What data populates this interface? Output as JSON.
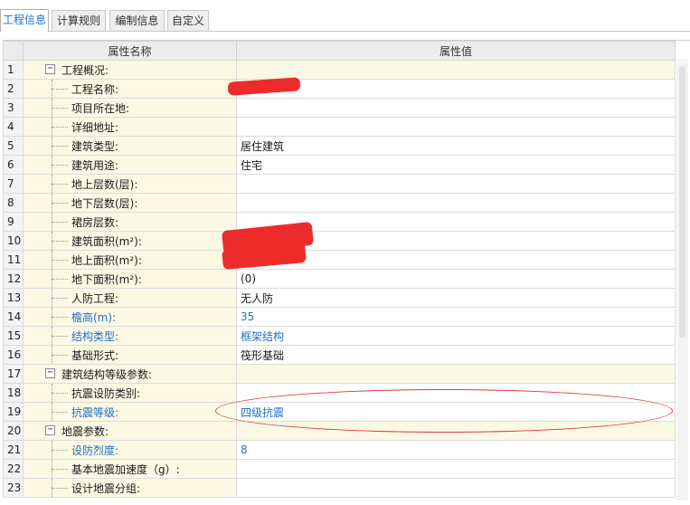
{
  "tabs": [
    {
      "label": "工程信息",
      "active": true
    },
    {
      "label": "计算规则",
      "active": false
    },
    {
      "label": "编制信息",
      "active": false
    },
    {
      "label": "自定义",
      "active": false
    }
  ],
  "grid": {
    "headers": {
      "name": "属性名称",
      "value": "属性值"
    },
    "rows": [
      {
        "num": "1",
        "name": "工程概况:",
        "value": "",
        "group": true,
        "expander": "−"
      },
      {
        "num": "2",
        "name": "工程名称:",
        "value": ""
      },
      {
        "num": "3",
        "name": "项目所在地:",
        "value": ""
      },
      {
        "num": "4",
        "name": "详细地址:",
        "value": ""
      },
      {
        "num": "5",
        "name": "建筑类型:",
        "value": "居住建筑"
      },
      {
        "num": "6",
        "name": "建筑用途:",
        "value": "住宅"
      },
      {
        "num": "7",
        "name": "地上层数(层):",
        "value": ""
      },
      {
        "num": "8",
        "name": "地下层数(层):",
        "value": ""
      },
      {
        "num": "9",
        "name": "裙房层数:",
        "value": ""
      },
      {
        "num": "10",
        "name": "建筑面积(m²):",
        "value": ""
      },
      {
        "num": "11",
        "name": "地上面积(m²):",
        "value": ""
      },
      {
        "num": "12",
        "name": "地下面积(m²):",
        "value": "(0)"
      },
      {
        "num": "13",
        "name": "人防工程:",
        "value": "无人防"
      },
      {
        "num": "14",
        "name": "檐高(m):",
        "value": "35",
        "blue": true
      },
      {
        "num": "15",
        "name": "结构类型:",
        "value": "框架结构",
        "blue": true
      },
      {
        "num": "16",
        "name": "基础形式:",
        "value": "筏形基础"
      },
      {
        "num": "17",
        "name": "建筑结构等级参数:",
        "value": "",
        "group": true,
        "expander": "−"
      },
      {
        "num": "18",
        "name": "抗震设防类别:",
        "value": ""
      },
      {
        "num": "19",
        "name": "抗震等级:",
        "value": "四级抗震",
        "blue": true
      },
      {
        "num": "20",
        "name": "地震参数:",
        "value": "",
        "group": true,
        "expander": "−"
      },
      {
        "num": "21",
        "name": "设防烈度:",
        "value": "8",
        "blue": true
      },
      {
        "num": "22",
        "name": "基本地震加速度（g）:",
        "value": ""
      },
      {
        "num": "23",
        "name": "设计地震分组:",
        "value": ""
      }
    ]
  }
}
